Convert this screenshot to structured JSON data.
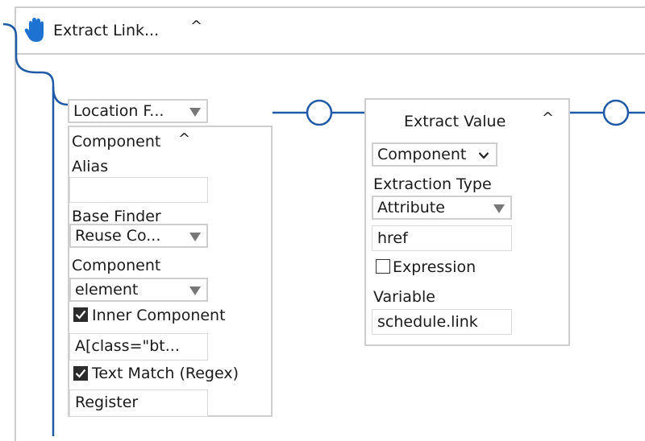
{
  "group": {
    "title": "Extract Link...",
    "icon": "hand-icon"
  },
  "location_finder": {
    "select_label": "Location F...",
    "component_header": "Component",
    "alias_label": "Alias",
    "alias_value": "",
    "base_finder_label": "Base Finder",
    "base_finder_value": "Reuse Co...",
    "component_label": "Component",
    "component_value": "element",
    "inner_component_label": "Inner Component",
    "inner_component_checked": true,
    "inner_component_value": "A[class=\"bt...",
    "text_match_label": "Text Match (Regex)",
    "text_match_checked": true,
    "text_match_value": "Register"
  },
  "extract_value": {
    "title": "Extract Value",
    "component_select": "Component",
    "extraction_type_label": "Extraction Type",
    "extraction_type_value": "Attribute",
    "attribute_value": "href",
    "expression_label": "Expression",
    "expression_checked": false,
    "variable_label": "Variable",
    "variable_value": "schedule.link"
  },
  "colors": {
    "connector": "#1f5aa6",
    "border": "#cfcfcf",
    "hand_icon": "#1e73d2"
  }
}
